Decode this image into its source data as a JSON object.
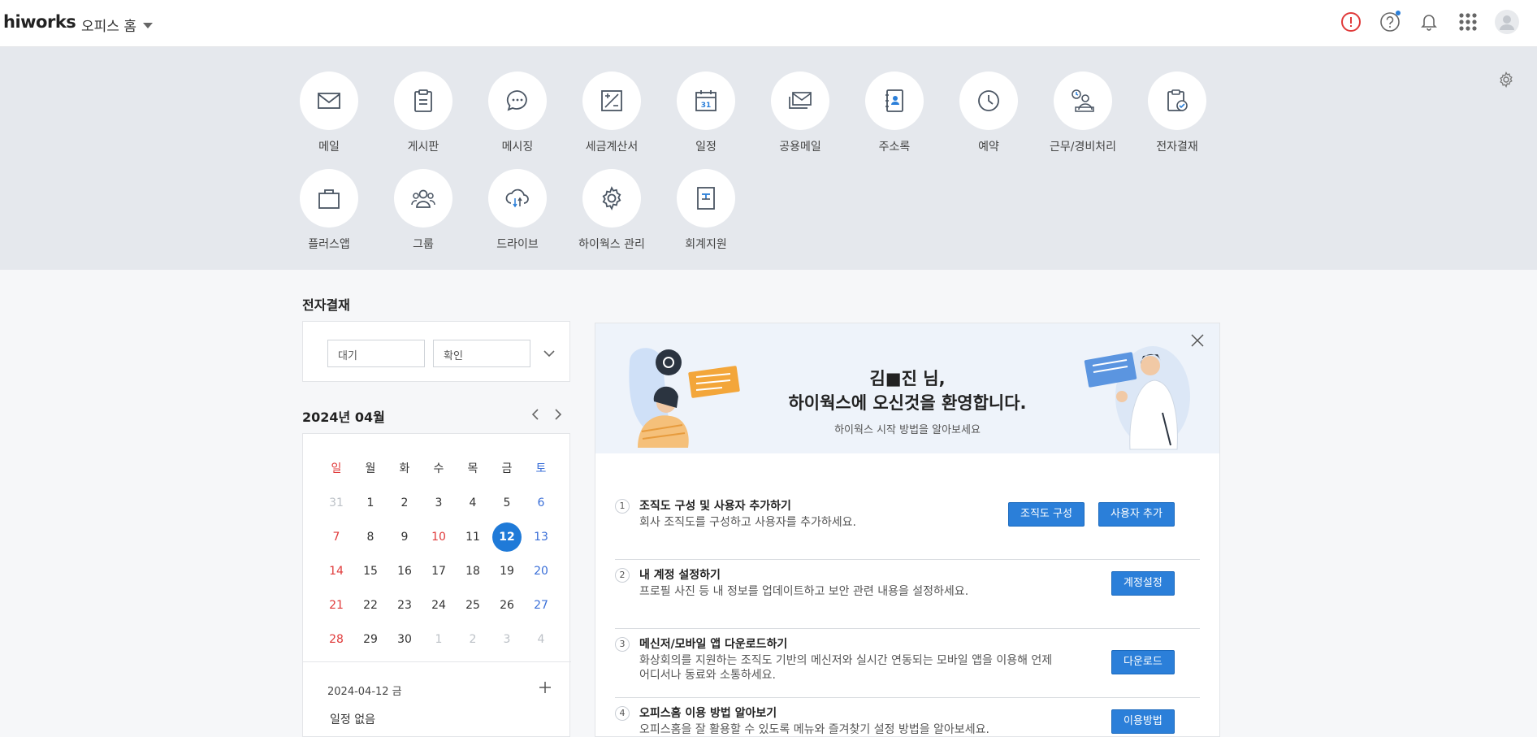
{
  "header": {
    "logo": "hiworks",
    "office_home": "오피스 홈"
  },
  "apps": [
    {
      "label": "메일",
      "icon": "mail-icon"
    },
    {
      "label": "게시판",
      "icon": "board-icon"
    },
    {
      "label": "메시징",
      "icon": "message-icon"
    },
    {
      "label": "세금계산서",
      "icon": "tax-invoice-icon"
    },
    {
      "label": "일정",
      "icon": "calendar-icon"
    },
    {
      "label": "공용메일",
      "icon": "shared-mail-icon"
    },
    {
      "label": "주소록",
      "icon": "address-book-icon"
    },
    {
      "label": "예약",
      "icon": "clock-icon"
    },
    {
      "label": "근무/경비처리",
      "icon": "work-expense-icon"
    },
    {
      "label": "전자결재",
      "icon": "approval-icon"
    },
    {
      "label": "플러스앱",
      "icon": "bag-icon"
    },
    {
      "label": "그룹",
      "icon": "group-icon"
    },
    {
      "label": "드라이브",
      "icon": "cloud-icon"
    },
    {
      "label": "하이웍스 관리",
      "icon": "gear-icon"
    },
    {
      "label": "회계지원",
      "icon": "accounting-icon"
    }
  ],
  "approval": {
    "title": "전자결재",
    "wait": "대기",
    "confirm": "확인"
  },
  "calendar": {
    "title": "2024년 04월",
    "calendar_number_icon": "31",
    "weekdays": [
      "일",
      "월",
      "화",
      "수",
      "목",
      "금",
      "토"
    ],
    "weeks": [
      [
        "31",
        "1",
        "2",
        "3",
        "4",
        "5",
        "6"
      ],
      [
        "7",
        "8",
        "9",
        "10",
        "11",
        "12",
        "13"
      ],
      [
        "14",
        "15",
        "16",
        "17",
        "18",
        "19",
        "20"
      ],
      [
        "21",
        "22",
        "23",
        "24",
        "25",
        "26",
        "27"
      ],
      [
        "28",
        "29",
        "30",
        "1",
        "2",
        "3",
        "4"
      ]
    ],
    "selected_date": "2024-04-12 금",
    "no_event": "일정 없음"
  },
  "welcome": {
    "name_line": "김■진 님,",
    "greeting": "하이웍스에 오신것을 환영합니다.",
    "sub": "하이웍스 시작 방법을 알아보세요",
    "steps": [
      {
        "num": "1",
        "title": "조직도 구성 및 사용자 추가하기",
        "desc": "회사 조직도를 구성하고 사용자를 추가하세요.",
        "buttons": [
          "조직도 구성",
          "사용자 추가"
        ]
      },
      {
        "num": "2",
        "title": "내 계정 설정하기",
        "desc": "프로필 사진 등 내 정보를 업데이트하고 보안 관련 내용을 설정하세요.",
        "buttons": [
          "계정설정"
        ]
      },
      {
        "num": "3",
        "title": "메신저/모바일 앱 다운로드하기",
        "desc": "화상회의를 지원하는 조직도 기반의 메신저와 실시간 연동되는 모바일 앱을 이용해 언제 어디서나 동료와 소통하세요.",
        "buttons": [
          "다운로드"
        ]
      },
      {
        "num": "4",
        "title": "오피스홈 이용 방법 알아보기",
        "desc": "오피스홈을 잘 활용할 수 있도록 메뉴와 즐겨찾기 설정 방법을 알아보세요.",
        "buttons": [
          "이용방법"
        ]
      }
    ]
  },
  "colors": {
    "accent": "#2b7fd9",
    "today": "#1f7ad8",
    "sunday": "#e03a3a",
    "saturday": "#3a6fd8",
    "alert": "#e03a3a"
  }
}
